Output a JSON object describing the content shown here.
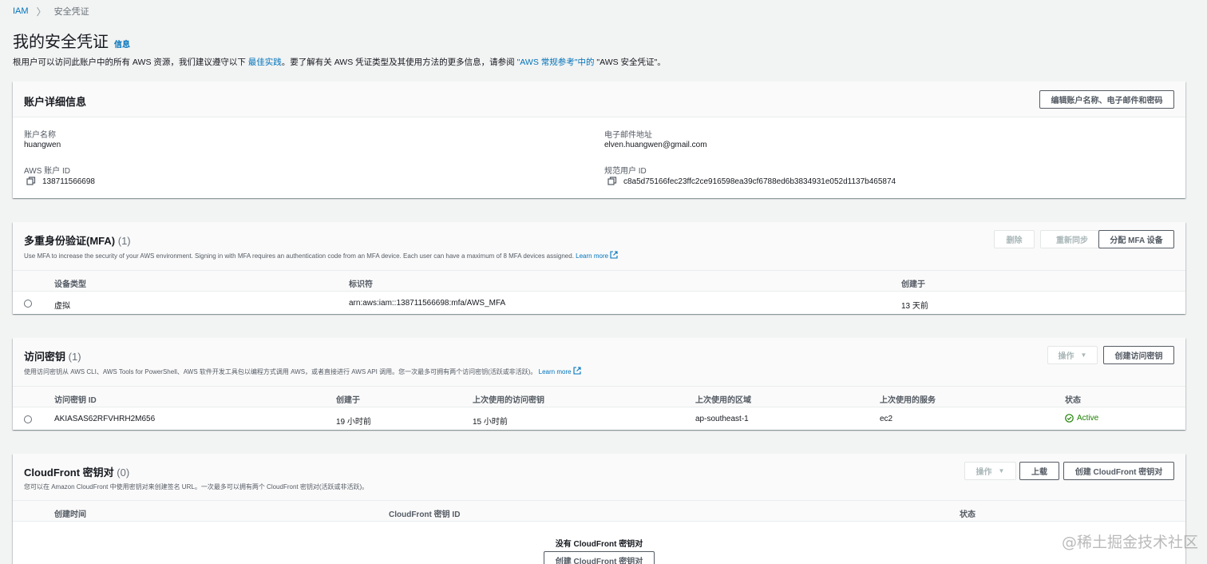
{
  "breadcrumb": {
    "root": "IAM",
    "sep": "〉",
    "current": "安全凭证"
  },
  "page": {
    "title": "我的安全凭证",
    "info_link": "信息",
    "intro_part1": "根用户可以访问此账户中的所有 AWS 资源，我们建议遵守以下 ",
    "intro_link1": "最佳实践",
    "intro_part2": "。要了解有关 AWS 凭证类型及其使用方法的更多信息，请参阅 ",
    "intro_link2": "\"AWS 常规参考\"中的",
    "intro_part3": " \"AWS 安全凭证\"。"
  },
  "account": {
    "title": "账户详细信息",
    "edit_button": "编辑账户名称、电子邮件和密码",
    "name_label": "账户名称",
    "name_value": "huangwen",
    "email_label": "电子邮件地址",
    "email_value": "elven.huangwen@gmail.com",
    "id_label": "AWS 账户 ID",
    "id_value": "138711566698",
    "canonical_label": "规范用户 ID",
    "canonical_value": "c8a5d75166fec23ffc2ce916598ea39cf6788ed6b3834931e052d1137b465874"
  },
  "mfa": {
    "title": "多重身份验证(MFA)",
    "count": "(1)",
    "desc": "Use MFA to increase the security of your AWS environment. Signing in with MFA requires an authentication code from an MFA device. Each user can have a maximum of 8 MFA devices assigned. ",
    "learn_more": "Learn more",
    "delete_button": "删除",
    "resync_button": "重新同步",
    "assign_button": "分配 MFA 设备",
    "columns": [
      "设备类型",
      "标识符",
      "创建于"
    ],
    "row": {
      "type": "虚拟",
      "identifier": "arn:aws:iam::138711566698:mfa/AWS_MFA",
      "created": "13 天前"
    }
  },
  "access_keys": {
    "title": "访问密钥",
    "count": "(1)",
    "desc": "使用访问密钥从 AWS CLI、AWS Tools for PowerShell、AWS 软件开发工具包以编程方式调用 AWS，或者直接进行 AWS API 调用。您一次最多可拥有两个访问密钥(活跃或非活跃)。 ",
    "learn_more": "Learn more",
    "actions_button": "操作",
    "create_button": "创建访问密钥",
    "columns": [
      "访问密钥 ID",
      "创建于",
      "上次使用的访问密钥",
      "上次使用的区域",
      "上次使用的服务",
      "状态"
    ],
    "row": {
      "id": "AKIASAS62RFVHRH2M656",
      "created": "19 小时前",
      "last_used": "15 小时前",
      "region": "ap-southeast-1",
      "service": "ec2",
      "status": "Active"
    },
    "status_color": "#1d8102"
  },
  "cloudfront": {
    "title": "CloudFront 密钥对",
    "count": "(0)",
    "desc": "您可以在 Amazon CloudFront 中使用密钥对来创建签名 URL。一次最多可以拥有两个 CloudFront 密钥对(活跃或非活跃)。",
    "actions_button": "操作",
    "upload_button": "上载",
    "create_button": "创建 CloudFront 密钥对",
    "columns": [
      "创建时间",
      "CloudFront 密钥 ID",
      "状态"
    ],
    "empty_text": "没有 CloudFront 密钥对",
    "empty_button": "创建 CloudFront 密钥对"
  },
  "watermark": "@稀土掘金技术社区",
  "colors": {
    "link": "#0073bb",
    "background": "#f2f3f3",
    "active": "#1d8102"
  }
}
